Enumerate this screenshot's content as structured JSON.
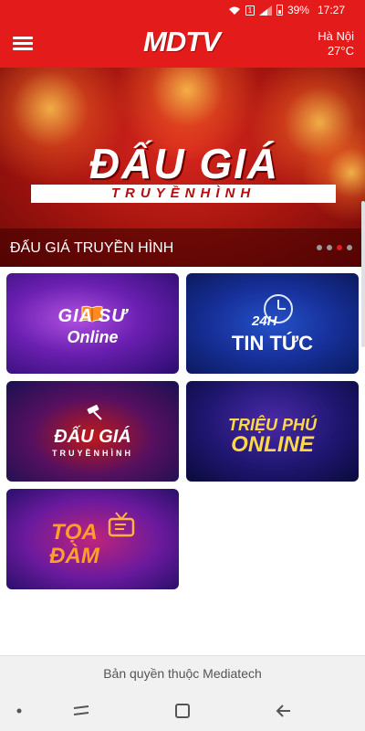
{
  "status_bar": {
    "battery_percent": "39%",
    "time": "17:27",
    "sim_label": "1"
  },
  "header": {
    "logo_text": "MDTV",
    "weather_city": "Hà Nội",
    "weather_temp": "27°C"
  },
  "banner": {
    "title": "ĐẤU GIÁ",
    "subtitle": "TRUYỀNHÌNH",
    "caption": "ĐẤU GIÁ TRUYỀN HÌNH",
    "active_slide": 3,
    "slide_count": 4
  },
  "tiles": [
    {
      "line1": "GIA   SƯ",
      "line2": "Online"
    },
    {
      "badge": "24H",
      "line1": "TIN TỨC"
    },
    {
      "line1": "ĐẤU GIÁ",
      "line2": "TRUYỀNHÌNH"
    },
    {
      "line1": "TRIỆU PHÚ",
      "line2": "ONLINE"
    },
    {
      "line1": "TỌA",
      "line2": "ĐÀM"
    }
  ],
  "footer": {
    "copyright": "Bản quyền thuộc Mediatech"
  },
  "colors": {
    "brand_red": "#e31b1b",
    "tile_label_yellow": "#ffd84a",
    "tile_label_orange": "#ff9f2a"
  }
}
